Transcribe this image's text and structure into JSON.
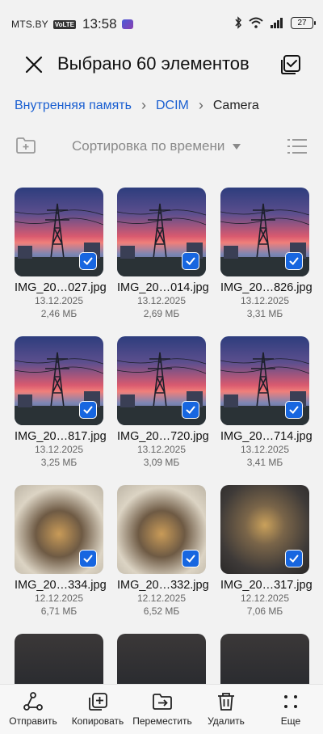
{
  "status_bar": {
    "carrier": "MTS.BY",
    "volte": "VoLTE",
    "time": "13:58",
    "battery": "27"
  },
  "header": {
    "title": "Выбрано 60 элементов",
    "close_icon": "close-icon",
    "select_all_icon": "select-all-icon"
  },
  "breadcrumb": {
    "items": [
      "Внутренняя память",
      "DCIM",
      "Camera"
    ]
  },
  "toolbar": {
    "sort_label": "Сортировка по времени",
    "new_folder_icon": "new-folder-icon",
    "list_view_icon": "list-view-icon"
  },
  "files": [
    {
      "name": "IMG_20…027.jpg",
      "date": "13.12.2025",
      "size": "2,46 МБ",
      "kind": "tower",
      "selected": true
    },
    {
      "name": "IMG_20…014.jpg",
      "date": "13.12.2025",
      "size": "2,69 МБ",
      "kind": "tower",
      "selected": true
    },
    {
      "name": "IMG_20…826.jpg",
      "date": "13.12.2025",
      "size": "3,31 МБ",
      "kind": "tower",
      "selected": true
    },
    {
      "name": "IMG_20…817.jpg",
      "date": "13.12.2025",
      "size": "3,25 МБ",
      "kind": "tower",
      "selected": true
    },
    {
      "name": "IMG_20…720.jpg",
      "date": "13.12.2025",
      "size": "3,09 МБ",
      "kind": "tower",
      "selected": true
    },
    {
      "name": "IMG_20…714.jpg",
      "date": "13.12.2025",
      "size": "3,41 МБ",
      "kind": "tower",
      "selected": true
    },
    {
      "name": "IMG_20…334.jpg",
      "date": "12.12.2025",
      "size": "6,71 МБ",
      "kind": "xmas",
      "selected": true
    },
    {
      "name": "IMG_20…332.jpg",
      "date": "12.12.2025",
      "size": "6,52 МБ",
      "kind": "xmas",
      "selected": true
    },
    {
      "name": "IMG_20…317.jpg",
      "date": "12.12.2025",
      "size": "7,06 МБ",
      "kind": "xmas2",
      "selected": true
    },
    {
      "name": "",
      "date": "",
      "size": "",
      "kind": "night",
      "selected": false
    },
    {
      "name": "",
      "date": "",
      "size": "",
      "kind": "night",
      "selected": false
    },
    {
      "name": "",
      "date": "",
      "size": "",
      "kind": "night",
      "selected": false
    }
  ],
  "bottom_bar": {
    "send": "Отправить",
    "copy": "Копировать",
    "move": "Переместить",
    "delete": "Удалить",
    "more": "Еще"
  }
}
